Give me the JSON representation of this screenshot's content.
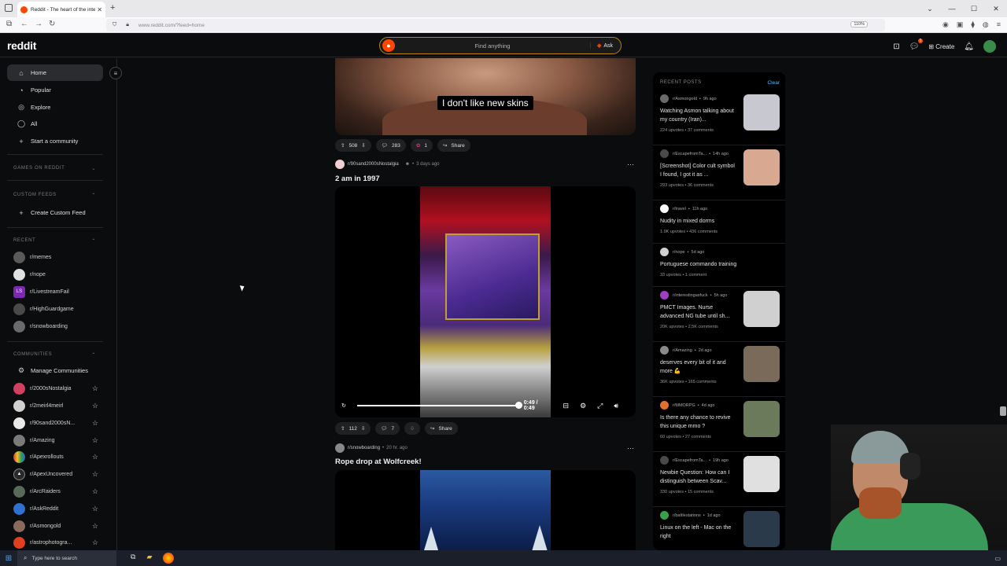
{
  "browser": {
    "tab_title": "Reddit - The heart of the intern",
    "url": "www.reddit.com/?feed=home",
    "zoom": "110%"
  },
  "header": {
    "logo": "reddit",
    "search_placeholder": "Find anything",
    "ask_label": "Ask",
    "create_label": "Create",
    "chat_badge": "1"
  },
  "sidebar": {
    "nav": [
      "Home",
      "Popular",
      "Explore",
      "All",
      "Start a community"
    ],
    "games_header": "GAMES ON REDDIT",
    "custom_feeds_header": "CUSTOM FEEDS",
    "create_custom_feed": "Create Custom Feed",
    "recent_header": "RECENT",
    "recent": [
      "r/memes",
      "r/nope",
      "r/LivestreamFail",
      "r/HighGuardgame",
      "r/snowboarding"
    ],
    "communities_header": "COMMUNITIES",
    "manage_communities": "Manage Communities",
    "communities": [
      "r/2000sNostalgia",
      "r/2meirl4meirl",
      "r/90sand2000sN...",
      "r/Amazing",
      "r/Apexrollouts",
      "r/ApexUncovered",
      "r/ArcRaiders",
      "r/AskReddit",
      "r/Asmongold",
      "r/astrophotogra..."
    ]
  },
  "feed": {
    "post1": {
      "caption": "I don't like new skins",
      "upvotes": "508",
      "comments": "283",
      "awards": "1",
      "share": "Share"
    },
    "post2": {
      "subreddit": "r/90sand2000sNostalgia",
      "age": "3 days ago",
      "title": "2 am in 1997",
      "time": "0:49 / 0:49",
      "upvotes": "112",
      "comments": "7",
      "share": "Share"
    },
    "post3": {
      "subreddit": "r/snowboarding",
      "age": "20 hr. ago",
      "title": "Rope drop at Wolfcreek!"
    }
  },
  "recent_posts": {
    "header": "RECENT POSTS",
    "clear": "Clear",
    "items": [
      {
        "sub": "r/Asmongold",
        "age": "9h ago",
        "title": "Watching Asmon talking about my country (Iran)...",
        "upvotes": "224 upvotes",
        "comments": "37 comments",
        "color": "#6a6a6a",
        "thumb": "#c8c8d0"
      },
      {
        "sub": "r/EscapefromTa...",
        "age": "14h ago",
        "title": "[Screenshot] Color cult symbol I found, I got it as ...",
        "upvotes": "293 upvotes",
        "comments": "36 comments",
        "color": "#4a4a4a",
        "thumb": "#d8a890"
      },
      {
        "sub": "r/travel",
        "age": "11h ago",
        "title": "Nudity in mixed dorms",
        "upvotes": "1.9K upvotes",
        "comments": "436 comments",
        "color": "#ffffff",
        "thumb": ""
      },
      {
        "sub": "r/nope",
        "age": "5d ago",
        "title": "Portuguese commando training",
        "upvotes": "33 upvotes",
        "comments": "1 comment",
        "color": "#d0d0d0",
        "thumb": ""
      },
      {
        "sub": "r/interestingasfuck",
        "age": "5h ago",
        "title": "PMCT Images. Nurse advanced NG tube until sh...",
        "upvotes": "20K upvotes",
        "comments": "2.5K comments",
        "color": "#a040c0",
        "thumb": "#d0d0d0"
      },
      {
        "sub": "r/Amazing",
        "age": "2d ago",
        "title": "deserves every bit of it and more 💪",
        "upvotes": "36K upvotes",
        "comments": "165 comments",
        "color": "#8a8a8a",
        "thumb": "#7a6a5a"
      },
      {
        "sub": "r/MMORPG",
        "age": "4d ago",
        "title": "Is there any chance to revive this unique mmo ?",
        "upvotes": "60 upvotes",
        "comments": "27 comments",
        "color": "#e07030",
        "thumb": "#6a7a5a"
      },
      {
        "sub": "r/EscapefromTa...",
        "age": "19h ago",
        "title": "Newbie Question: How can I distinguish between Scav...",
        "upvotes": "330 upvotes",
        "comments": "15 comments",
        "color": "#4a4a4a",
        "thumb": "#e0e0e0"
      },
      {
        "sub": "r/battlestations",
        "age": "1d ago",
        "title": "Linux on the left - Mac on the right",
        "upvotes": "",
        "comments": "",
        "color": "#3aa04a",
        "thumb": "#2a3a4a"
      }
    ]
  },
  "taskbar": {
    "search": "Type here to search"
  }
}
